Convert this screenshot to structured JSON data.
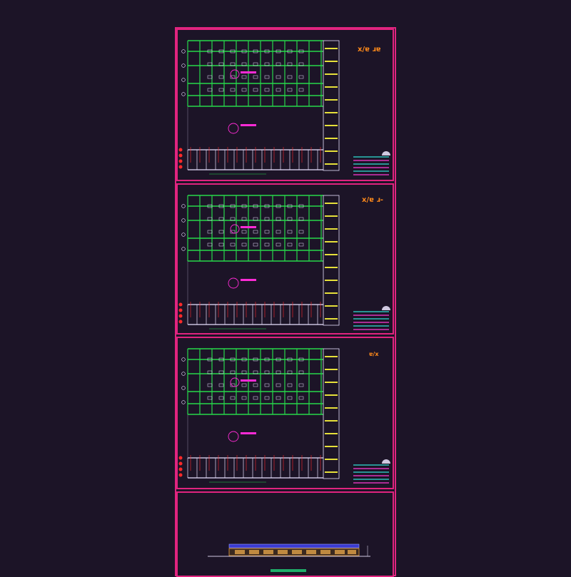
{
  "sheets": [
    {
      "title": "x/ɐ ɹɐ"
    },
    {
      "title": "x/ɐ ɹ-"
    },
    {
      "title": "ɐ/x"
    },
    {
      "title": ""
    }
  ],
  "colors": {
    "background": "#1c1427",
    "frame": "#e0247f",
    "grid": "#27d84a",
    "columns": "#e8e0ff",
    "stair": "#e6e03a",
    "label": "#ff2bd6",
    "title": "#ff8a1a",
    "axis_marker": "#ff2a2a"
  }
}
